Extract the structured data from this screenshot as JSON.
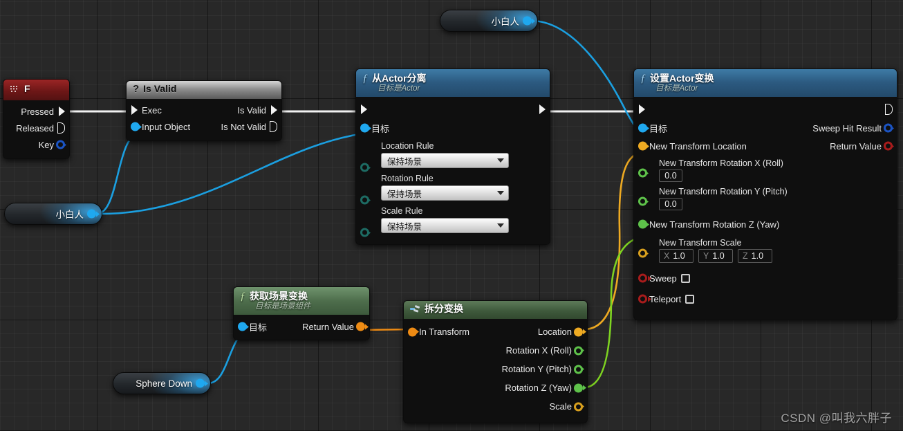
{
  "watermark": "CSDN @叫我六胖子",
  "nodes": {
    "key_event": {
      "title": "F",
      "icon": "keyboard-icon",
      "pins": [
        {
          "label": "Pressed",
          "kind": "exec-out",
          "connected": true
        },
        {
          "label": "Released",
          "kind": "exec-out",
          "connected": false
        },
        {
          "label": "Key",
          "kind": "data-out",
          "color": "#1b54c4",
          "connected": false
        }
      ]
    },
    "is_valid": {
      "title": "Is Valid",
      "icon": "question-icon",
      "in_pins": [
        {
          "label": "Exec",
          "kind": "exec-in",
          "connected": true
        },
        {
          "label": "Input Object",
          "kind": "data-in",
          "color": "#1fa8ef",
          "connected": true
        }
      ],
      "out_pins": [
        {
          "label": "Is Valid",
          "kind": "exec-out",
          "connected": true
        },
        {
          "label": "Is Not Valid",
          "kind": "exec-out",
          "connected": false
        }
      ]
    },
    "detach_from_actor": {
      "title": "从Actor分离",
      "subtitle": "目标是Actor",
      "icon": "function-icon",
      "target_label": "目标",
      "fields": [
        {
          "label": "Location Rule",
          "value": "保持场景"
        },
        {
          "label": "Rotation Rule",
          "value": "保持场景"
        },
        {
          "label": "Scale Rule",
          "value": "保持场景"
        }
      ]
    },
    "set_actor_transform": {
      "title": "设置Actor变换",
      "subtitle": "目标是Actor",
      "icon": "function-icon",
      "in_pins": [
        {
          "label": "目标",
          "color": "#1fa8ef",
          "connected": true
        },
        {
          "label": "New Transform Location",
          "color": "#eeaa22",
          "connected": true
        },
        {
          "label": "New Transform Rotation X (Roll)",
          "color": "#5ec24a",
          "connected": false,
          "value": "0.0"
        },
        {
          "label": "New Transform Rotation Y (Pitch)",
          "color": "#5ec24a",
          "connected": false,
          "value": "0.0"
        },
        {
          "label": "New Transform Rotation Z (Yaw)",
          "color": "#5ec24a",
          "connected": true
        },
        {
          "label": "New Transform Scale",
          "color": "#d9a01e",
          "connected": false,
          "vector": [
            {
              "axis": "X",
              "value": "1.0"
            },
            {
              "axis": "Y",
              "value": "1.0"
            },
            {
              "axis": "Z",
              "value": "1.0"
            }
          ]
        },
        {
          "label": "Sweep",
          "color": "#a81c1c",
          "connected": false,
          "checkbox": true
        },
        {
          "label": "Teleport",
          "color": "#a81c1c",
          "connected": false,
          "checkbox": true
        }
      ],
      "out_pins": [
        {
          "label": "Sweep Hit Result",
          "color": "#1b54c4",
          "connected": false
        },
        {
          "label": "Return Value",
          "color": "#a81c1c",
          "connected": false
        }
      ]
    },
    "get_world_transform": {
      "title": "获取场景变换",
      "subtitle": "目标是场景组件",
      "icon": "function-icon",
      "in_pins": [
        {
          "label": "目标",
          "color": "#1fa8ef",
          "connected": true
        }
      ],
      "out_pins": [
        {
          "label": "Return Value",
          "color": "#ee8b14",
          "connected": true
        }
      ]
    },
    "break_transform": {
      "title": "拆分变换",
      "icon": "split-icon",
      "in_pins": [
        {
          "label": "In Transform",
          "color": "#ee8b14",
          "connected": true
        }
      ],
      "out_pins": [
        {
          "label": "Location",
          "color": "#eeaa22",
          "connected": true
        },
        {
          "label": "Rotation X (Roll)",
          "color": "#5ec24a",
          "connected": false
        },
        {
          "label": "Rotation Y (Pitch)",
          "color": "#5ec24a",
          "connected": false
        },
        {
          "label": "Rotation Z (Yaw)",
          "color": "#5ec24a",
          "connected": true
        },
        {
          "label": "Scale",
          "color": "#d9a01e",
          "connected": false
        }
      ]
    },
    "var_xiaobairen_top": {
      "label": "小白人"
    },
    "var_xiaobairen_left": {
      "label": "小白人"
    },
    "var_sphere_down": {
      "label": "Sphere Down"
    }
  },
  "colors": {
    "exec_wire": "#f2f2f2",
    "object_wire": "#1b9fe0",
    "transform_wire": "#ee8b14",
    "vector_wire": "#eeaa22",
    "float_wire": "#7ed321",
    "graph_background": "#282828"
  }
}
